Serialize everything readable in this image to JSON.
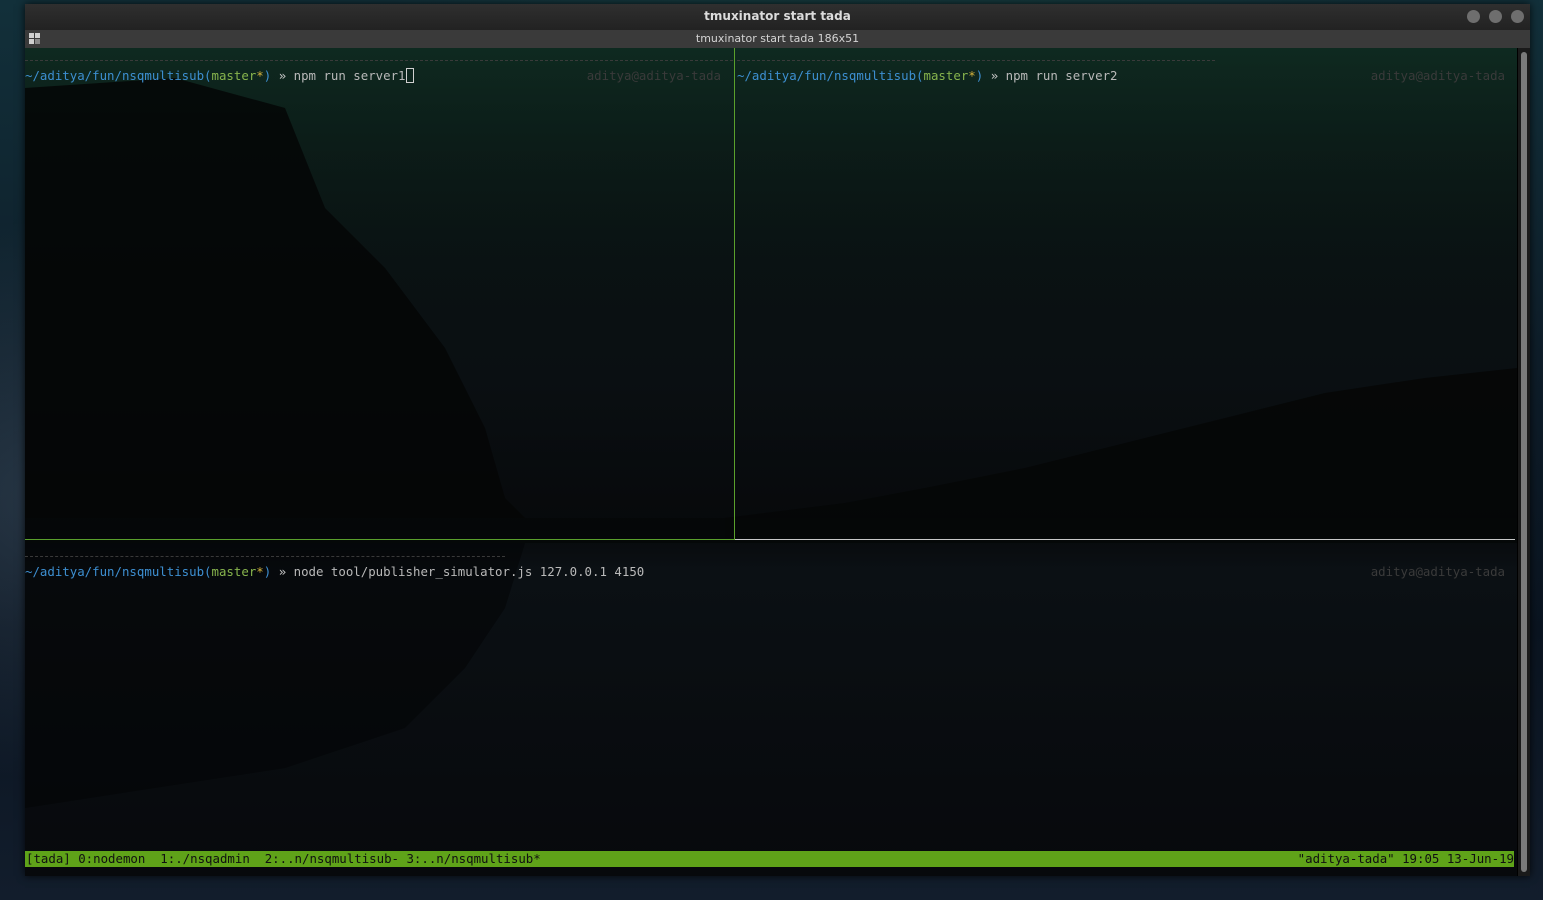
{
  "window": {
    "title": "tmuxinator start tada",
    "tab_title": "tmuxinator start tada 186x51"
  },
  "panes": [
    {
      "id": "top-left",
      "path": "~/aditya/fun/nsqmultisub",
      "branch": "master",
      "dirty_marker": "*",
      "arrow": "»",
      "command": "npm run server1",
      "host": "aditya@aditya-tada",
      "active": true
    },
    {
      "id": "top-right",
      "path": "~/aditya/fun/nsqmultisub",
      "branch": "master",
      "dirty_marker": "*",
      "arrow": "»",
      "command": "npm run server2",
      "host": "aditya@aditya-tada",
      "active": false
    },
    {
      "id": "bottom",
      "path": "~/aditya/fun/nsqmultisub",
      "branch": "master",
      "dirty_marker": "*",
      "arrow": "»",
      "command": "node tool/publisher_simulator.js 127.0.0.1 4150",
      "host": "aditya@aditya-tada",
      "active": false
    }
  ],
  "statusbar": {
    "left": "[tada] 0:nodemon  1:./nsqadmin  2:..n/nsqmultisub- 3:..n/nsqmultisub*",
    "right": "\"aditya-tada\" 19:05 13-Jun-19"
  },
  "colors": {
    "path": "#3d8fd1",
    "branch": "#87b44d",
    "dirty": "#d6b33c",
    "status_bg": "#5fa319",
    "active_border": "#5aa02c"
  },
  "icons": {
    "tab_menu": "grid-icon",
    "window_buttons": [
      "minimize-icon",
      "maximize-icon",
      "close-icon"
    ]
  }
}
